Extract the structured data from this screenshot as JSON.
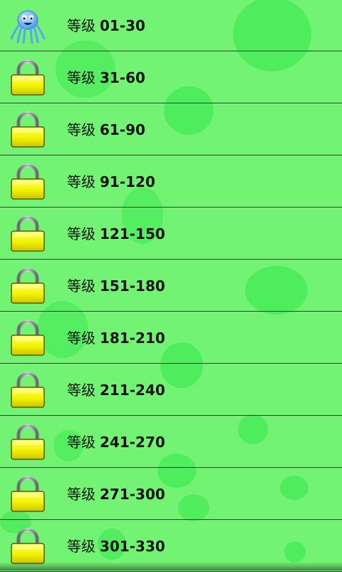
{
  "levels": {
    "prefix": "等级",
    "items": [
      {
        "range": "01-30",
        "icon": "octopus-icon",
        "locked": false
      },
      {
        "range": "31-60",
        "icon": "lock-icon",
        "locked": true
      },
      {
        "range": "61-90",
        "icon": "lock-icon",
        "locked": true
      },
      {
        "range": "91-120",
        "icon": "lock-icon",
        "locked": true
      },
      {
        "range": "121-150",
        "icon": "lock-icon",
        "locked": true
      },
      {
        "range": "151-180",
        "icon": "lock-icon",
        "locked": true
      },
      {
        "range": "181-210",
        "icon": "lock-icon",
        "locked": true
      },
      {
        "range": "211-240",
        "icon": "lock-icon",
        "locked": true
      },
      {
        "range": "241-270",
        "icon": "lock-icon",
        "locked": true
      },
      {
        "range": "271-300",
        "icon": "lock-icon",
        "locked": true
      },
      {
        "range": "301-330",
        "icon": "lock-icon",
        "locked": true
      }
    ]
  },
  "colors": {
    "background": "#73f373",
    "bubble": "#2fe84a",
    "lock_body": "#f2f200",
    "lock_shackle": "#9aa0a0"
  }
}
